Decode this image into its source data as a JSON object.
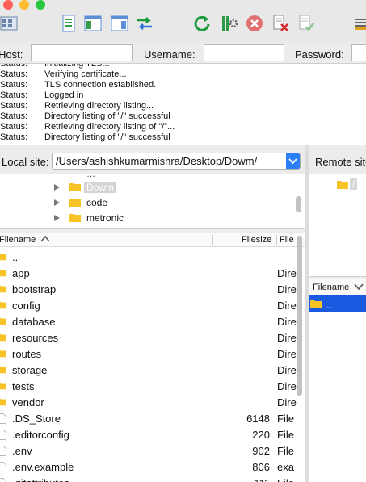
{
  "toolbar": {
    "icons": [
      "site-manager-icon",
      "toggle-log-icon",
      "toggle-local-tree-icon",
      "toggle-remote-tree-icon",
      "sync-browse-icon",
      "refresh-icon",
      "process-queue-icon",
      "cancel-icon",
      "disconnect-icon",
      "reconnect-icon",
      "filter-icon"
    ]
  },
  "quickconnect": {
    "host_label": "Host:",
    "username_label": "Username:",
    "password_label": "Password:",
    "host_value": "",
    "username_value": "",
    "password_value": ""
  },
  "log": [
    {
      "k": "Status:",
      "v": "Initializing TLS..."
    },
    {
      "k": "Status:",
      "v": "Verifying certificate..."
    },
    {
      "k": "Status:",
      "v": "TLS connection established."
    },
    {
      "k": "Status:",
      "v": "Logged in"
    },
    {
      "k": "Status:",
      "v": "Retrieving directory listing..."
    },
    {
      "k": "Status:",
      "v": "Directory listing of \"/\" successful"
    },
    {
      "k": "Status:",
      "v": "Retrieving directory listing of \"/\"..."
    },
    {
      "k": "Status:",
      "v": "Directory listing of \"/\" successful"
    }
  ],
  "local": {
    "label": "Local site:",
    "path": "/Users/ashishkumarmishra/Desktop/Dowm/",
    "tree": [
      {
        "name": "Dowm",
        "selected": true
      },
      {
        "name": "code",
        "selected": false
      },
      {
        "name": "metronic",
        "selected": false
      }
    ],
    "columns": {
      "filename": "Filename",
      "filesize": "Filesize",
      "filetype": "File"
    },
    "rows": [
      {
        "name": "..",
        "size": "",
        "type": "",
        "folder": true
      },
      {
        "name": "app",
        "size": "",
        "type": "Dire",
        "folder": true
      },
      {
        "name": "bootstrap",
        "size": "",
        "type": "Dire",
        "folder": true
      },
      {
        "name": "config",
        "size": "",
        "type": "Dire",
        "folder": true
      },
      {
        "name": "database",
        "size": "",
        "type": "Dire",
        "folder": true
      },
      {
        "name": "resources",
        "size": "",
        "type": "Dire",
        "folder": true
      },
      {
        "name": "routes",
        "size": "",
        "type": "Dire",
        "folder": true
      },
      {
        "name": "storage",
        "size": "",
        "type": "Dire",
        "folder": true
      },
      {
        "name": "tests",
        "size": "",
        "type": "Dire",
        "folder": true
      },
      {
        "name": "vendor",
        "size": "",
        "type": "Dire",
        "folder": true
      },
      {
        "name": ".DS_Store",
        "size": "6148",
        "type": "File",
        "folder": false
      },
      {
        "name": ".editorconfig",
        "size": "220",
        "type": "File",
        "folder": false
      },
      {
        "name": ".env",
        "size": "902",
        "type": "File",
        "folder": false
      },
      {
        "name": ".env.example",
        "size": "806",
        "type": "exa",
        "folder": false
      },
      {
        "name": ".gitattributes",
        "size": "111",
        "type": "File",
        "folder": false
      }
    ]
  },
  "remote": {
    "label": "Remote site:",
    "tree_root": "/",
    "columns": {
      "filename": "Filename"
    },
    "rows": [
      {
        "name": ".."
      }
    ]
  }
}
